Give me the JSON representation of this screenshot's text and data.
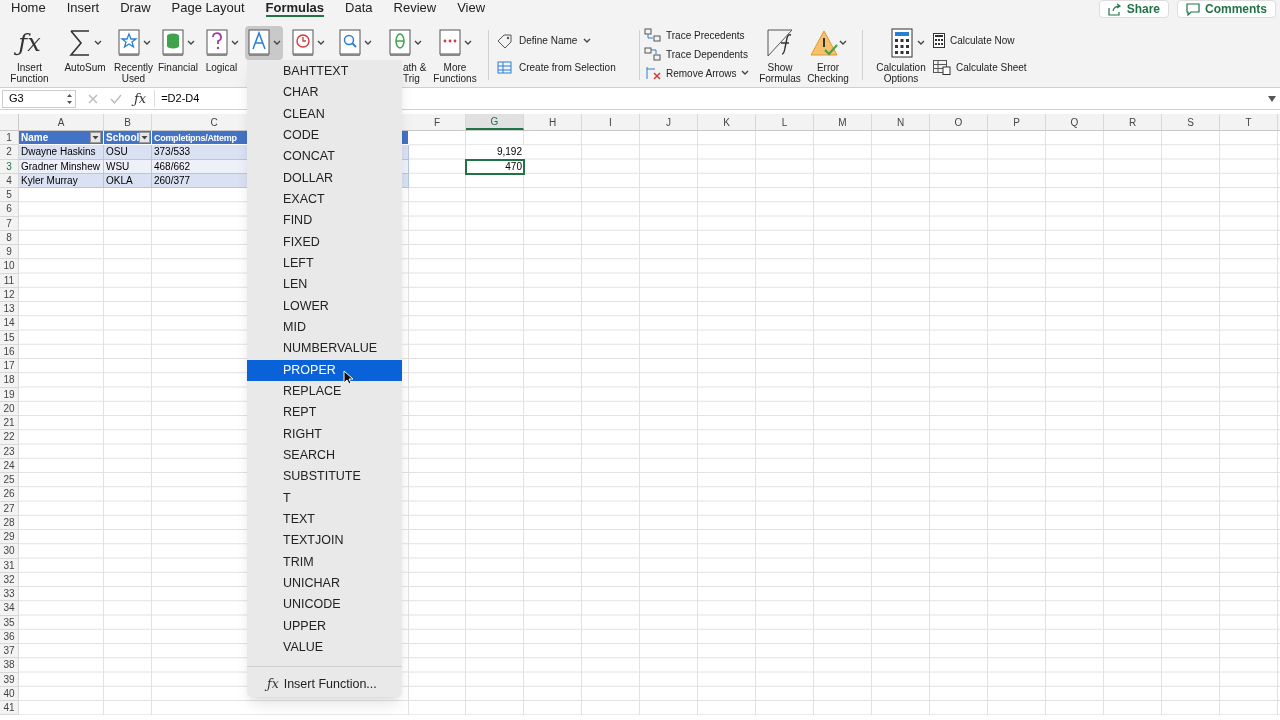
{
  "menu_tabs": [
    {
      "label": "Home",
      "selected": false
    },
    {
      "label": "Insert",
      "selected": false
    },
    {
      "label": "Draw",
      "selected": false
    },
    {
      "label": "Page Layout",
      "selected": false
    },
    {
      "label": "Formulas",
      "selected": true
    },
    {
      "label": "Data",
      "selected": false
    },
    {
      "label": "Review",
      "selected": false
    },
    {
      "label": "View",
      "selected": false
    }
  ],
  "share_buttons": [
    {
      "kind": "share",
      "label": "Share"
    },
    {
      "kind": "comments",
      "label": "Comments"
    }
  ],
  "ribbon": {
    "functions": [
      {
        "kind": "fx",
        "symbol": "ƒx",
        "label": "Insert Function",
        "dropdown": false,
        "selected": false
      },
      {
        "kind": "sum",
        "label": "AutoSum",
        "dropdown": true,
        "selected": false
      },
      {
        "kind": "star",
        "label": "Recently Used",
        "dropdown": true,
        "selected": false
      },
      {
        "kind": "db",
        "label": "Financial",
        "dropdown": true,
        "selected": false
      },
      {
        "kind": "question",
        "label": "Logical",
        "dropdown": true,
        "selected": false
      },
      {
        "kind": "text",
        "dropdown": true,
        "selected": true
      },
      {
        "kind": "clock",
        "dropdown": true,
        "selected": false
      },
      {
        "kind": "search",
        "dropdown": true,
        "selected": false
      },
      {
        "kind": "theta",
        "label": "ath & Trig",
        "dropdown": true,
        "selected": false
      },
      {
        "kind": "dots",
        "label": "More Functions",
        "dropdown": true,
        "selected": false
      }
    ],
    "names": [
      {
        "kind": "tag",
        "label": "Define Name",
        "dropdown": true
      },
      {
        "kind": "table",
        "label": "Create from Selection",
        "dropdown": false
      }
    ],
    "auditing": [
      {
        "kind": "precedents",
        "label": "Trace Precedents",
        "dropdown": false
      },
      {
        "kind": "dependents",
        "label": "Trace Dependents",
        "dropdown": false
      },
      {
        "kind": "remove",
        "label": "Remove Arrows",
        "dropdown": true
      }
    ],
    "auditing_big": [
      {
        "kind": "showfx",
        "label": "Show Formulas",
        "dropdown": false
      },
      {
        "kind": "warning",
        "label": "Error Checking",
        "dropdown": true
      }
    ],
    "calculation": {
      "label": "Calculation Options",
      "items": [
        {
          "kind": "calc",
          "label": "Calculate Now"
        },
        {
          "kind": "sheet",
          "label": "Calculate Sheet"
        }
      ]
    }
  },
  "formula_bar": {
    "name_box": "G3",
    "fx_symbol": "ƒx",
    "formula": "=D2-D4"
  },
  "columns": [
    {
      "label": "A",
      "selected": false
    },
    {
      "label": "B",
      "selected": false
    },
    {
      "label": "C",
      "selected": false
    },
    {
      "label": "F",
      "selected": false
    },
    {
      "label": "G",
      "selected": true
    },
    {
      "label": "H",
      "selected": false
    },
    {
      "label": "I",
      "selected": false
    },
    {
      "label": "J",
      "selected": false
    },
    {
      "label": "K",
      "selected": false
    },
    {
      "label": "L",
      "selected": false
    },
    {
      "label": "M",
      "selected": false
    },
    {
      "label": "N",
      "selected": false
    },
    {
      "label": "O",
      "selected": false
    },
    {
      "label": "P",
      "selected": false
    },
    {
      "label": "Q",
      "selected": false
    },
    {
      "label": "R",
      "selected": false
    },
    {
      "label": "S",
      "selected": false
    },
    {
      "label": "T",
      "selected": false
    }
  ],
  "table_header": [
    "Name",
    "School",
    "Completipns/Attemp"
  ],
  "rows": [
    {
      "cells": [
        "Dwayne Haskins",
        "OSU",
        "373/533"
      ],
      "g": "9,192",
      "selected": false
    },
    {
      "cells": [
        "Gradner Minshew",
        "WSU",
        "468/662"
      ],
      "g": "470",
      "selected": true
    },
    {
      "cells": [
        "Kyler Murray",
        "OKLA",
        "260/377"
      ],
      "selected": false
    }
  ],
  "row_labels": [
    "1",
    "2",
    "3",
    "4",
    "5",
    "6",
    "7",
    "8",
    "9",
    "10",
    "11",
    "12",
    "13",
    "14",
    "15",
    "16",
    "17",
    "18",
    "19",
    "20",
    "21",
    "22",
    "23",
    "24",
    "25",
    "26",
    "27",
    "28",
    "29",
    "30",
    "31",
    "32",
    "33",
    "34",
    "35",
    "36",
    "37",
    "38",
    "39",
    "40",
    "41"
  ],
  "text_menu": {
    "items": [
      {
        "label": "BAHTTEXT",
        "selected": false
      },
      {
        "label": "CHAR",
        "selected": false
      },
      {
        "label": "CLEAN",
        "selected": false
      },
      {
        "label": "CODE",
        "selected": false
      },
      {
        "label": "CONCAT",
        "selected": false
      },
      {
        "label": "DOLLAR",
        "selected": false
      },
      {
        "label": "EXACT",
        "selected": false
      },
      {
        "label": "FIND",
        "selected": false
      },
      {
        "label": "FIXED",
        "selected": false
      },
      {
        "label": "LEFT",
        "selected": false
      },
      {
        "label": "LEN",
        "selected": false
      },
      {
        "label": "LOWER",
        "selected": false
      },
      {
        "label": "MID",
        "selected": false
      },
      {
        "label": "NUMBERVALUE",
        "selected": false
      },
      {
        "label": "PROPER",
        "selected": true
      },
      {
        "label": "REPLACE",
        "selected": false
      },
      {
        "label": "REPT",
        "selected": false
      },
      {
        "label": "RIGHT",
        "selected": false
      },
      {
        "label": "SEARCH",
        "selected": false
      },
      {
        "label": "SUBSTITUTE",
        "selected": false
      },
      {
        "label": "T",
        "selected": false
      },
      {
        "label": "TEXT",
        "selected": false
      },
      {
        "label": "TEXTJOIN",
        "selected": false
      },
      {
        "label": "TRIM",
        "selected": false
      },
      {
        "label": "UNICHAR",
        "selected": false
      },
      {
        "label": "UNICODE",
        "selected": false
      },
      {
        "label": "UPPER",
        "selected": false
      },
      {
        "label": "VALUE",
        "selected": false
      }
    ],
    "footer": {
      "symbol": "ƒx",
      "label": "Insert Function..."
    }
  }
}
